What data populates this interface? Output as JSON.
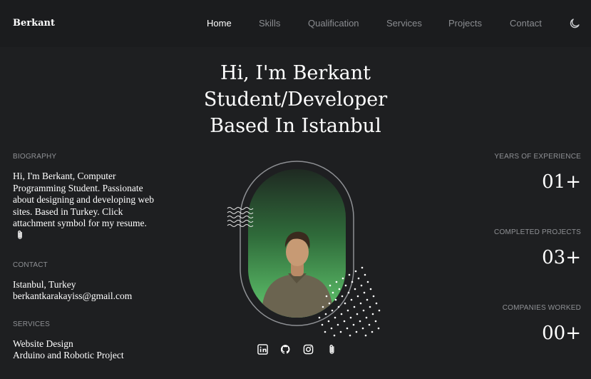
{
  "header": {
    "brand": "Berkant",
    "nav": [
      "Home",
      "Skills",
      "Qualification",
      "Services",
      "Projects",
      "Contact"
    ],
    "active": "Home",
    "theme_icon": "moon-icon"
  },
  "hero": {
    "line1": "Hi, I'm Berkant",
    "line2": "Student/Developer",
    "line3": "Based In Istanbul"
  },
  "biography": {
    "label": "BIOGRAPHY",
    "text": "Hi, I'm Berkant, Computer Programming Student. Passionate about designing and developing web sites. Based in Turkey. Click attachment symbol for my resume."
  },
  "contact": {
    "label": "CONTACT",
    "location": "Istanbul, Turkey",
    "email": "berkantkarakayiss@gmail.com"
  },
  "services": {
    "label": "SERVICES",
    "items": [
      "Website Design",
      "Arduino and Robotic Project"
    ]
  },
  "stats": [
    {
      "label": "YEARS OF EXPERIENCE",
      "value": "01+"
    },
    {
      "label": "COMPLETED PROJECTS",
      "value": "03+"
    },
    {
      "label": "COMPANIES WORKED",
      "value": "00+"
    }
  ],
  "socials": [
    "linkedin-icon",
    "github-icon",
    "instagram-icon",
    "paperclip-icon"
  ],
  "colors": {
    "background": "#1e1f21",
    "topbar": "#1b1c1e",
    "muted": "#8a8c90",
    "gradient_green": "#5cc36b"
  }
}
